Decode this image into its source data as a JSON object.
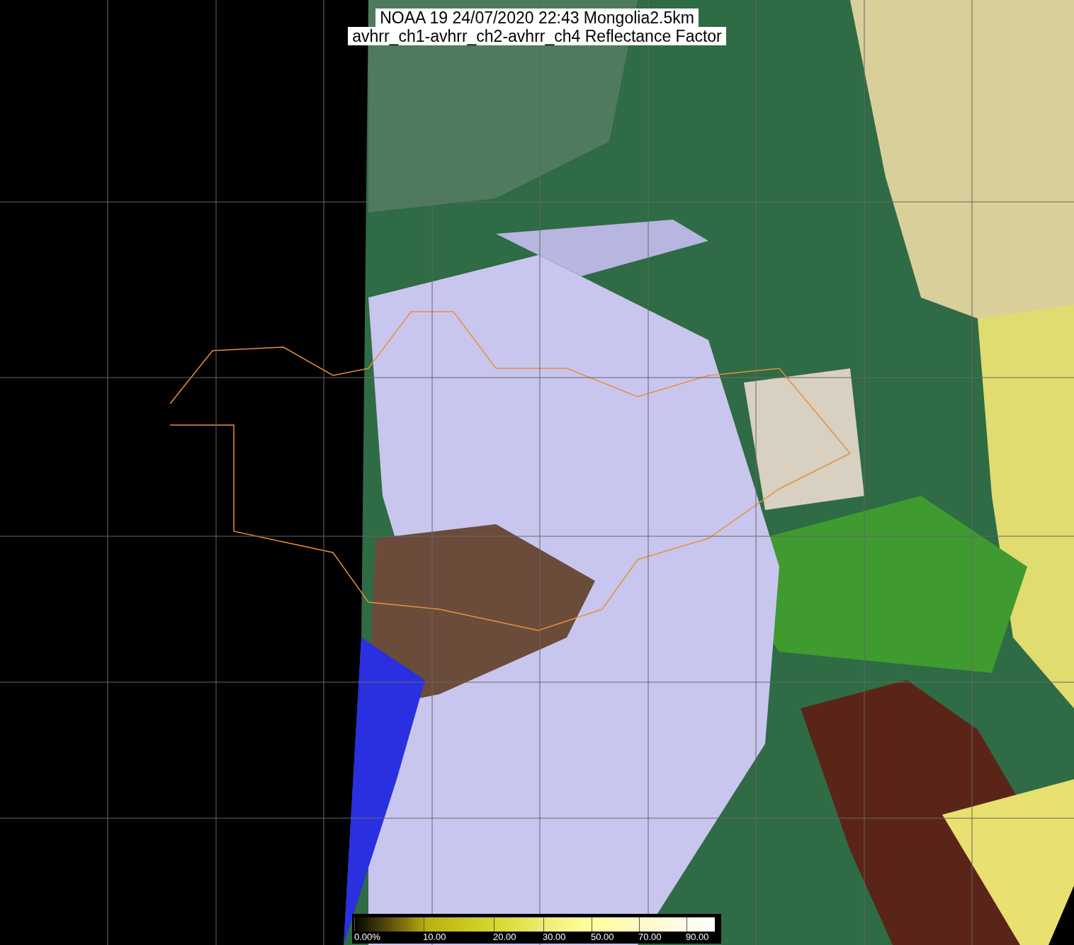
{
  "title": {
    "lines": [
      "NOAA 19 24/07/2020 22:43 Mongolia2.5km",
      "avhrr_ch1-avhrr_ch2-avhrr_ch4 Reflectance Factor"
    ]
  },
  "legend": {
    "ticks": [
      "0.00%",
      "10.00",
      "20.00",
      "30.00",
      "50.00",
      "70.00",
      "90.00"
    ]
  }
}
